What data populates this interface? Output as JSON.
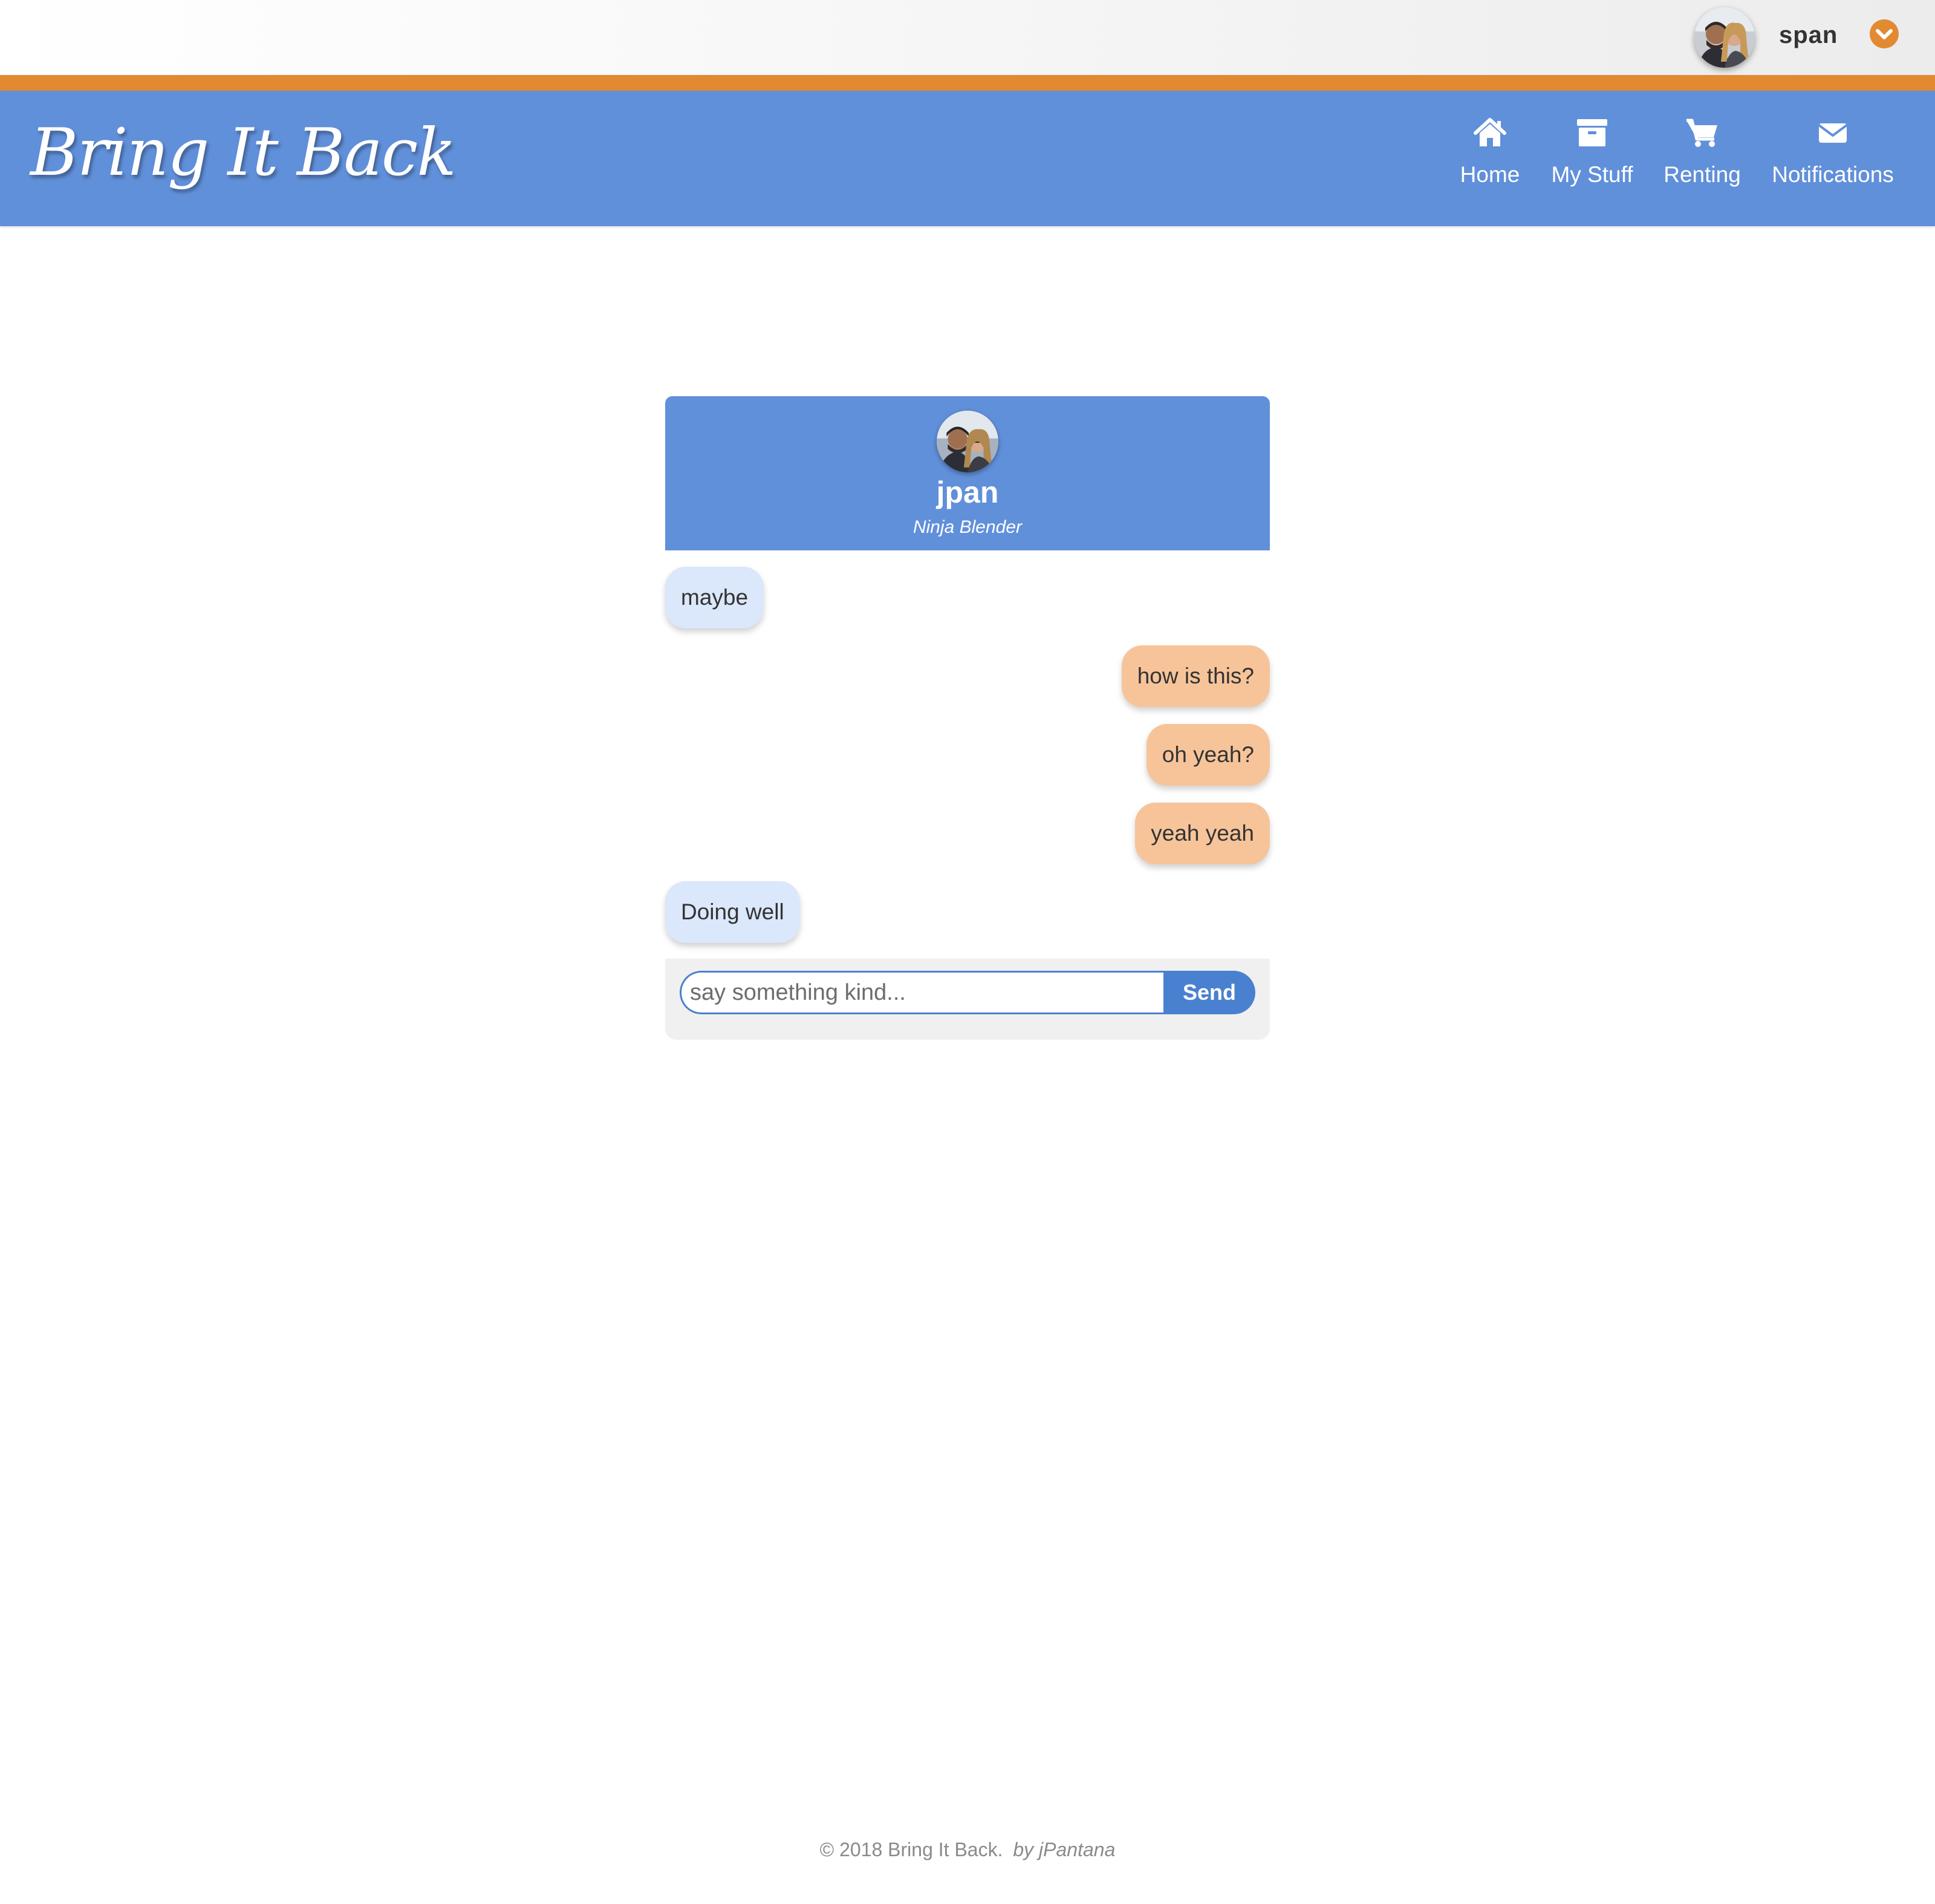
{
  "user_bar": {
    "username": "span",
    "avatar_icon": "couple-avatar-photo",
    "dropdown_icon": "chevron-down-circle-icon"
  },
  "brand": {
    "name": "Bring It Back"
  },
  "nav": {
    "items": [
      {
        "label": "Home",
        "icon": "home-icon"
      },
      {
        "label": "My Stuff",
        "icon": "archive-box-icon"
      },
      {
        "label": "Renting",
        "icon": "shopping-cart-icon"
      },
      {
        "label": "Notifications",
        "icon": "envelope-icon"
      }
    ]
  },
  "chat": {
    "partner": {
      "username": "jpan",
      "title": "Ninja Blender"
    },
    "messages": [
      {
        "text": "maybe",
        "direction": "incoming"
      },
      {
        "text": "how is this?",
        "direction": "outgoing"
      },
      {
        "text": "oh yeah?",
        "direction": "outgoing"
      },
      {
        "text": "yeah yeah",
        "direction": "outgoing"
      },
      {
        "text": "Doing well",
        "direction": "incoming"
      }
    ],
    "composer": {
      "placeholder": "say something kind...",
      "value": "",
      "send_label": "Send"
    }
  },
  "footer": {
    "copyright": "© 2018 Bring It Back.",
    "author": "by jPantana"
  },
  "colors": {
    "primary_blue": "#6190da",
    "accent_orange": "#e28a32",
    "incoming_bubble": "#dbe7fb",
    "outgoing_bubble": "#f7c49a",
    "send_button": "#4a80d0"
  }
}
